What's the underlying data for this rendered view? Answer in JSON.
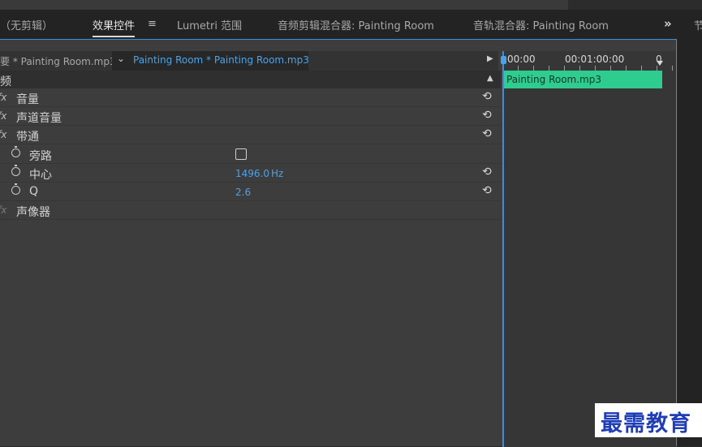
{
  "tabs": [
    {
      "label": "（无剪辑）",
      "active": false
    },
    {
      "label": "效果控件",
      "active": true
    },
    {
      "label": "Lumetri 范围",
      "active": false
    },
    {
      "label": "音频剪辑混合器: Painting Room",
      "active": false
    },
    {
      "label": "音轨混合器: Painting Room",
      "active": false
    }
  ],
  "tab_menu_symbol": "≡",
  "overflow_symbol": "»",
  "right_tab_partial": "节",
  "source": {
    "master_label": "要 * Painting Room.mp3",
    "clip_label": "Painting Room * Painting Room.mp3",
    "chevron": "⌄",
    "play_symbol": "▶"
  },
  "section": {
    "label": "频",
    "collapse_symbol": "▲"
  },
  "effects": [
    {
      "fx": "fx",
      "label": "音量"
    },
    {
      "fx": "fx",
      "label": "声道音量"
    },
    {
      "fx": "fx",
      "label": "带通"
    }
  ],
  "params": {
    "bypass": {
      "label": "旁路",
      "checked": false
    },
    "center": {
      "label": "中心",
      "value": "1496.0",
      "unit": "Hz"
    },
    "q": {
      "label": "Q",
      "value": "2.6"
    }
  },
  "panner": {
    "fx": "fx",
    "label": "声像器"
  },
  "reset_symbol": "⟲",
  "timeline": {
    "times": [
      "00:00",
      "00:01:00:00",
      "0"
    ],
    "clip_name": "Painting Room.mp3"
  },
  "watermark": "最需教育",
  "colors": {
    "accent_blue": "#3b8fd6",
    "value_blue": "#4aa3ea",
    "clip_green": "#2ecc8f",
    "watermark_blue": "#1f3db5"
  }
}
